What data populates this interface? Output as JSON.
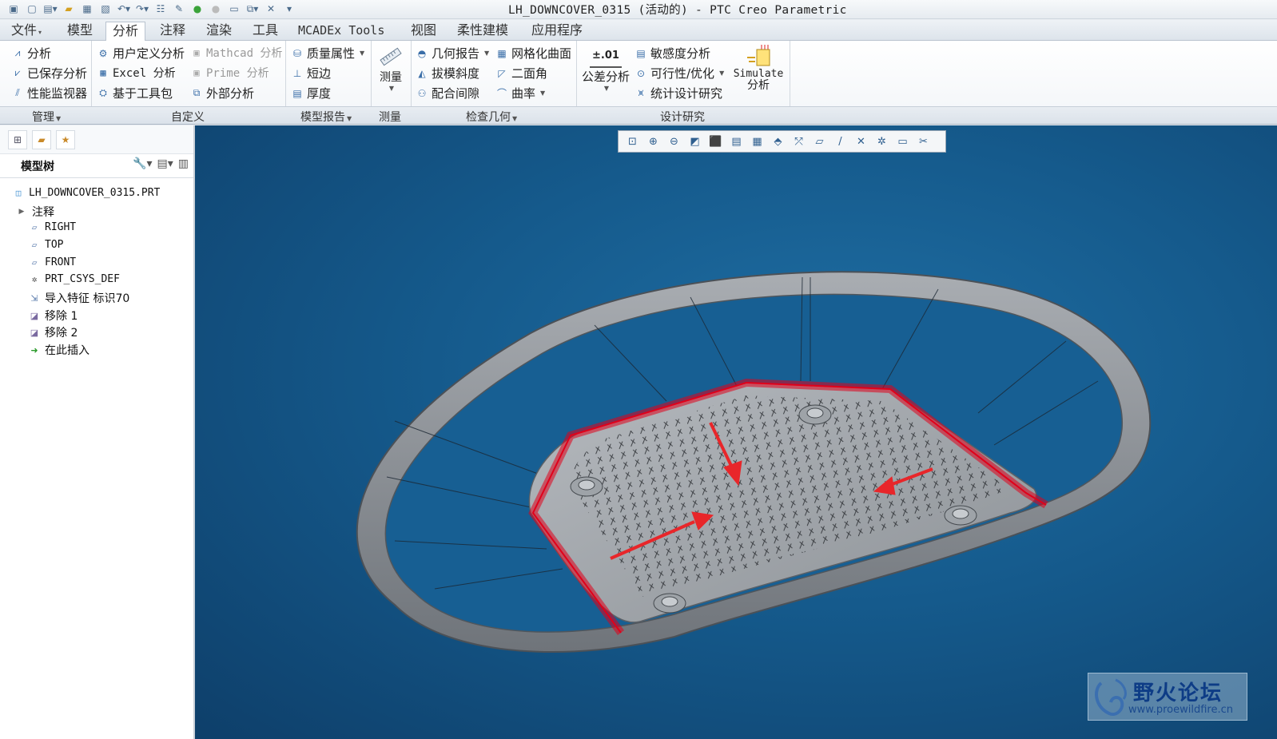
{
  "window": {
    "title": "LH_DOWNCOVER_0315 (活动的) - PTC Creo Parametric"
  },
  "qat": {
    "icons": [
      "app-icon",
      "new-icon",
      "open-dropdown-icon",
      "open-icon",
      "save-icon",
      "save-copy-icon",
      "undo-icon",
      "redo-icon",
      "regenerate-icon",
      "edit-icon",
      "green-ball-icon",
      "gray-ball-icon",
      "window-icon",
      "switch-window-icon",
      "close-window-icon",
      "customize-icon"
    ]
  },
  "tabs": [
    {
      "label": "文件",
      "dropdown": "▾"
    },
    {
      "label": "模型"
    },
    {
      "label": "分析"
    },
    {
      "label": "注释"
    },
    {
      "label": "渲染"
    },
    {
      "label": "工具"
    },
    {
      "label": "MCADEx Tools"
    },
    {
      "label": "视图"
    },
    {
      "label": "柔性建模"
    },
    {
      "label": "应用程序"
    }
  ],
  "ribbon": {
    "manage": {
      "analysis": "分析",
      "saved_analysis": "已保存分析",
      "perf_monitor": "性能监视器"
    },
    "custom": {
      "user_defined": "用户定义分析",
      "excel": "Excel 分析",
      "toolkit": "基于工具包",
      "mathcad": "Mathcad 分析",
      "prime": "Prime 分析",
      "external": "外部分析"
    },
    "model_report": {
      "mass_props": "质量属性",
      "short_edge": "短边",
      "thickness": "厚度"
    },
    "measure": {
      "label": "测量"
    },
    "inspect": {
      "geom_report": "几何报告",
      "draft": "拔模斜度",
      "clearance": "配合间隙",
      "mesh_surface": "网格化曲面",
      "dihedral": "二面角",
      "curvature": "曲率"
    },
    "design_study": {
      "tol_badge": "±.01",
      "tol_analysis": "公差分析",
      "sensitivity": "敏感度分析",
      "feasibility": "可行性/优化",
      "statistical": "统计设计研究",
      "simulate_1": "Simulate",
      "simulate_2": "分析"
    },
    "groups": {
      "manage": "管理",
      "custom": "自定义",
      "model_report": "模型报告",
      "measure": "测量",
      "inspect": "检查几何",
      "design_study": "设计研究"
    }
  },
  "model_tree": {
    "title": "模型树",
    "items": [
      {
        "label": "LH_DOWNCOVER_0315.PRT",
        "icon": "part-icon"
      },
      {
        "label": "注释",
        "icon": "expand-arrow-icon"
      },
      {
        "label": "RIGHT",
        "icon": "datum-plane-icon"
      },
      {
        "label": "TOP",
        "icon": "datum-plane-icon"
      },
      {
        "label": "FRONT",
        "icon": "datum-plane-icon"
      },
      {
        "label": "PRT_CSYS_DEF",
        "icon": "csys-icon"
      },
      {
        "label": "导入特征 标识70",
        "icon": "import-feature-icon"
      },
      {
        "label": "移除 1",
        "icon": "remove-feature-icon"
      },
      {
        "label": "移除 2",
        "icon": "remove-feature-icon"
      },
      {
        "label": "在此插入",
        "icon": "insert-here-arrow-icon"
      }
    ]
  },
  "viewport": {
    "toolbar_icons": [
      "refit-icon",
      "zoom-in-icon",
      "zoom-out-icon",
      "repaint-icon",
      "display-style-icon",
      "saved-orientations-icon",
      "view-manager-icon",
      "perspective-icon",
      "datum-display-icon",
      "plane-display-icon",
      "axis-display-icon",
      "point-display-icon",
      "csys-display-icon",
      "annotation-display-icon",
      "spin-center-icon"
    ],
    "background_color": "#155a8c",
    "highlight_color": "#e0001a"
  },
  "watermark": {
    "title": "野火论坛",
    "url": "www.proewildfire.cn"
  }
}
